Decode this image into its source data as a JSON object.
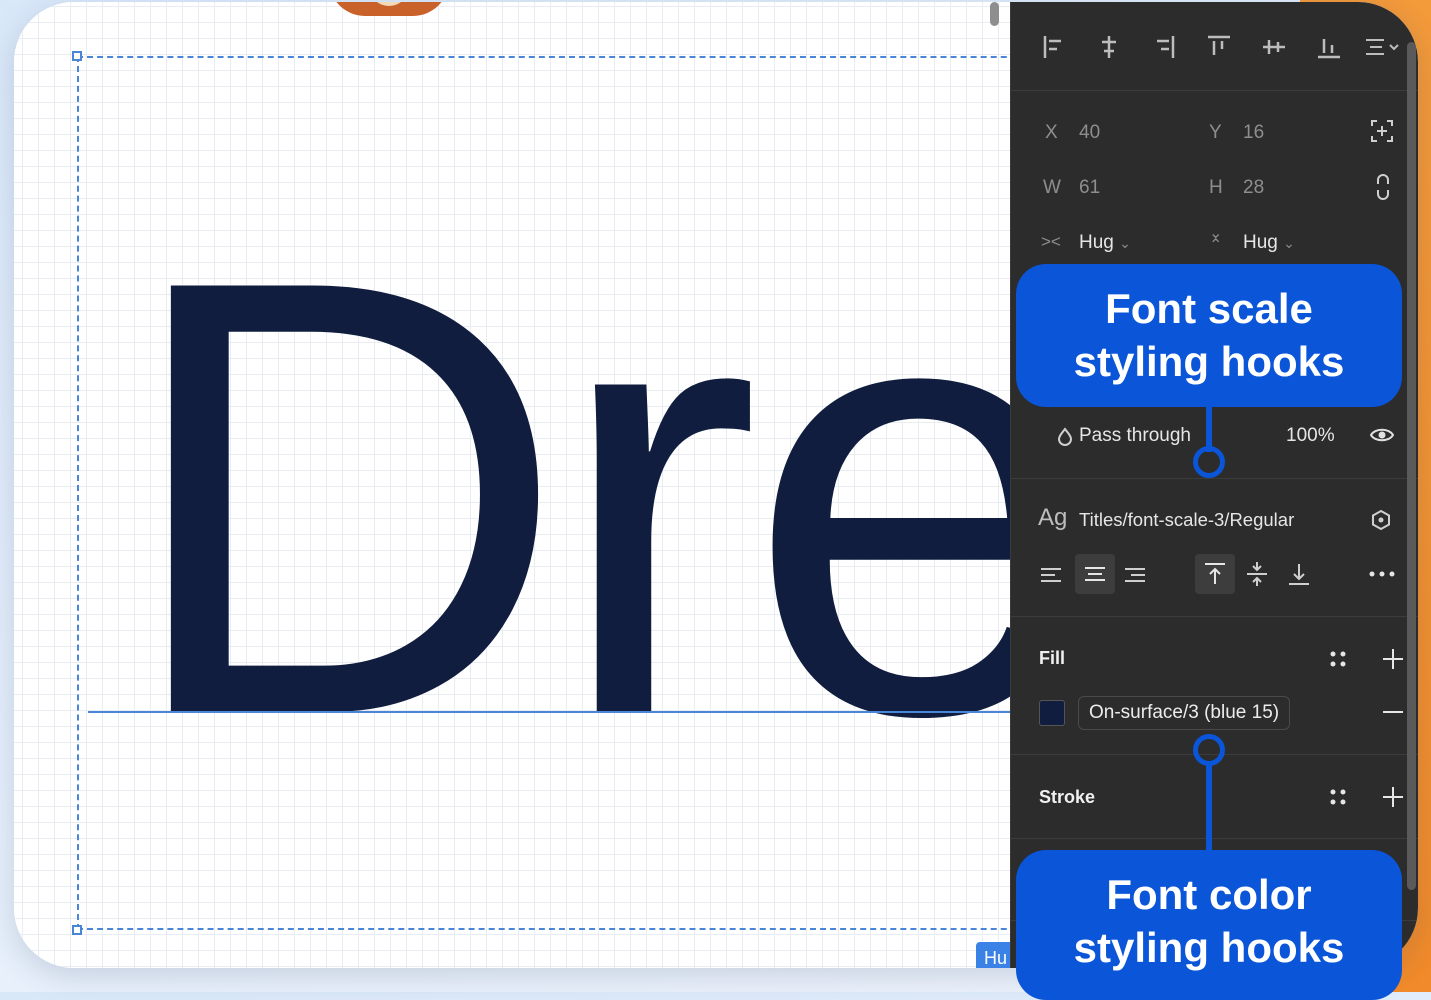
{
  "canvas": {
    "display_text": "Dre",
    "selection_label": "Hu"
  },
  "panel": {
    "position": {
      "x_label": "X",
      "x_value": "40",
      "y_label": "Y",
      "y_value": "16",
      "w_label": "W",
      "w_value": "61",
      "h_label": "H",
      "h_value": "28"
    },
    "resizing": {
      "horizontal": "Hug",
      "vertical": "Hug"
    },
    "layer": {
      "blend_mode": "Pass through",
      "opacity": "100%"
    },
    "text": {
      "ag_label": "Ag",
      "style_name": "Titles/font-scale-3/Regular"
    },
    "fill": {
      "title": "Fill",
      "token": "On-surface/3 (blue 15)",
      "color": "#101d3f"
    },
    "stroke": {
      "title": "Stroke"
    }
  },
  "callouts": {
    "top_line1": "Font scale",
    "top_line2": "styling hooks",
    "bottom_line1": "Font color",
    "bottom_line2": "styling hooks"
  },
  "colors": {
    "accent": "#0a55d8",
    "text_dark": "#101d3f",
    "panel_bg": "#2c2c2c",
    "orange": "#f08a2a"
  }
}
